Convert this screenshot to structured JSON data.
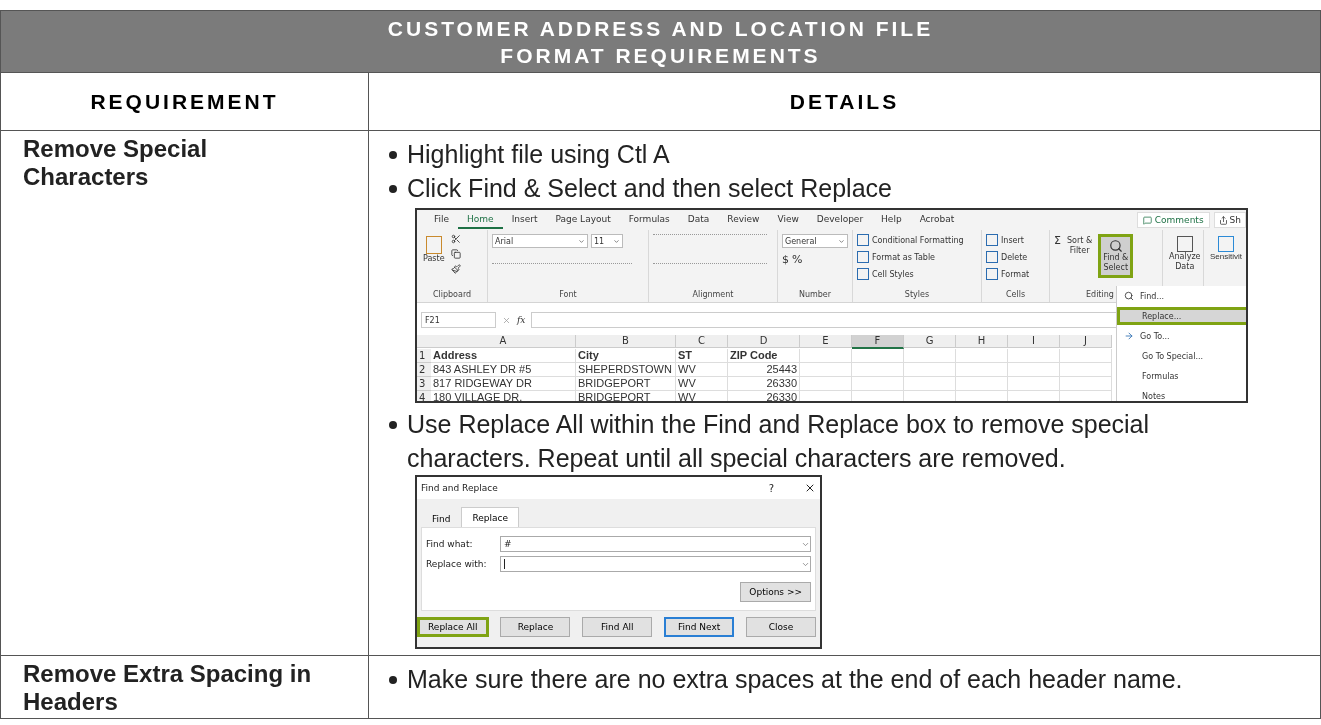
{
  "title_lines": [
    "CUSTOMER ADDRESS AND LOCATION FILE",
    "FORMAT REQUIREMENTS"
  ],
  "columns": [
    "REQUIREMENT",
    "DETAILS"
  ],
  "rows": [
    {
      "requirement": "Remove Special Characters",
      "details": [
        {
          "kind": "bullet",
          "text": "Highlight file using Ctl A"
        },
        {
          "kind": "bullet",
          "text": "Click Find & Select and then select Replace"
        },
        {
          "kind": "excel",
          "tabs": [
            {
              "label": "File",
              "selected": false
            },
            {
              "label": "Home",
              "selected": true
            },
            {
              "label": "Insert",
              "selected": false
            },
            {
              "label": "Page Layout",
              "selected": false
            },
            {
              "label": "Formulas",
              "selected": false
            },
            {
              "label": "Data",
              "selected": false
            },
            {
              "label": "Review",
              "selected": false
            },
            {
              "label": "View",
              "selected": false
            },
            {
              "label": "Developer",
              "selected": false
            },
            {
              "label": "Help",
              "selected": false
            },
            {
              "label": "Acrobat",
              "selected": false
            }
          ],
          "comments_button": "Comments",
          "share_button": "Sh",
          "paste_label": "Paste",
          "font_name": "Arial",
          "font_size": "11",
          "number_format": "General",
          "number_symbols": [
            "$",
            "%"
          ],
          "style_items": [
            "Conditional Formatting",
            "Format as Table",
            "Cell Styles"
          ],
          "cell_items": [
            "Insert",
            "Delete",
            "Format"
          ],
          "sum_symbol": "Σ",
          "sort_filter": [
            "Sort &",
            "Filter"
          ],
          "find_select": {
            "lines": [
              "Find &",
              "Select"
            ],
            "highlighted": true
          },
          "analyze": [
            "Analyze",
            "Data"
          ],
          "sensitivity": "Sensitivit",
          "group_labels": [
            "Clipboard",
            "Font",
            "Alignment",
            "Number",
            "Styles",
            "Cells",
            "Editing"
          ],
          "name_box": "F21",
          "formula_label": "fx",
          "grid_columns": [
            {
              "label": "A",
              "selected": false
            },
            {
              "label": "B",
              "selected": false
            },
            {
              "label": "C",
              "selected": false
            },
            {
              "label": "D",
              "selected": false
            },
            {
              "label": "E",
              "selected": false
            },
            {
              "label": "F",
              "selected": true
            },
            {
              "label": "G",
              "selected": false
            },
            {
              "label": "H",
              "selected": false
            },
            {
              "label": "I",
              "selected": false
            },
            {
              "label": "J",
              "selected": false
            }
          ],
          "grid_rows": [
            {
              "number": "1",
              "header": true,
              "cells": [
                "Address",
                "City",
                "ST",
                "ZIP Code"
              ]
            },
            {
              "number": "2",
              "header": false,
              "cells": [
                "843 ASHLEY DR #5",
                "SHEPERDSTOWN",
                "WV",
                "25443"
              ]
            },
            {
              "number": "3",
              "header": false,
              "cells": [
                "817 RIDGEWAY DR",
                "BRIDGEPORT",
                "WV",
                "26330"
              ]
            },
            {
              "number": "4",
              "header": false,
              "cells": [
                "180 VILLAGE DR.",
                "BRIDGEPORT",
                "WV",
                "26330"
              ]
            }
          ],
          "menu": [
            {
              "label": "Find...",
              "highlighted": false
            },
            {
              "label": "Replace...",
              "highlighted": true
            },
            {
              "label": "Go To...",
              "highlighted": false
            },
            {
              "label": "Go To Special...",
              "highlighted": false
            },
            {
              "label": "Formulas",
              "highlighted": false
            },
            {
              "label": "Notes",
              "highlighted": false
            }
          ]
        },
        {
          "kind": "bullet",
          "text": "Use Replace All within the Find and Replace box to remove special characters. Repeat until all special characters are removed."
        },
        {
          "kind": "dialog",
          "title": "Find and Replace",
          "help": "?",
          "tabs": [
            {
              "label": "Find",
              "selected": false
            },
            {
              "label": "Replace",
              "selected": true
            }
          ],
          "fields": [
            {
              "label": "Find what:",
              "value": "#"
            },
            {
              "label": "Replace with:"
            }
          ],
          "options_button": "Options >>",
          "buttons": [
            {
              "label": "Replace All",
              "highlighted": true,
              "default": false
            },
            {
              "label": "Replace",
              "highlighted": false,
              "default": false
            },
            {
              "label": "Find All",
              "highlighted": false,
              "default": false
            },
            {
              "label": "Find Next",
              "highlighted": false,
              "default": true
            },
            {
              "label": "Close",
              "highlighted": false,
              "default": false
            }
          ]
        }
      ]
    },
    {
      "requirement": "Remove Extra Spacing in Headers",
      "details": [
        {
          "kind": "bullet",
          "text": "Make sure there are no extra spaces at the end of each header name."
        }
      ]
    }
  ]
}
